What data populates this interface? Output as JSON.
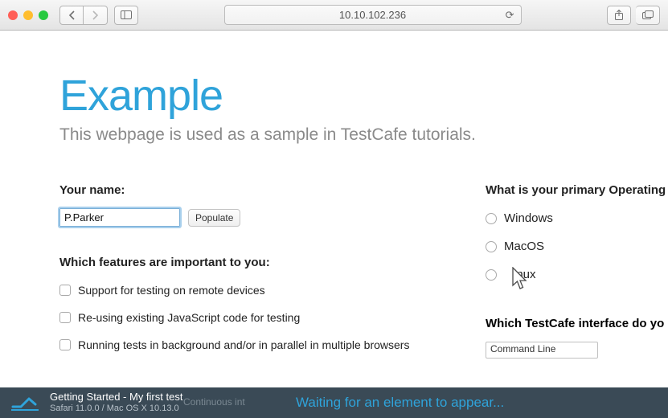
{
  "browser": {
    "address": "10.10.102.236",
    "traffic_colors": {
      "close": "#ff5f57",
      "min": "#ffbd2e",
      "max": "#28c940"
    }
  },
  "page": {
    "heading": "Example",
    "subtitle": "This webpage is used as a sample in TestCafe tutorials.",
    "name_label": "Your name:",
    "name_value": "P.Parker",
    "populate_label": "Populate",
    "features_label": "Which features are important to you:",
    "features": [
      "Support for testing on remote devices",
      "Re-using existing JavaScript code for testing",
      "Running tests in background and/or in parallel in multiple browsers"
    ],
    "os_label": "What is your primary Operating",
    "os_options": [
      "Windows",
      "MacOS",
      "inux"
    ],
    "iface_label": "Which TestCafe interface do yo",
    "iface_value": "Command Line"
  },
  "status": {
    "title": "Getting Started - My first test",
    "env": "Safari 11.0.0 / Mac OS X 10.13.0",
    "ghost_text": "Continuous int",
    "waiting": "Waiting for an element to appear..."
  }
}
